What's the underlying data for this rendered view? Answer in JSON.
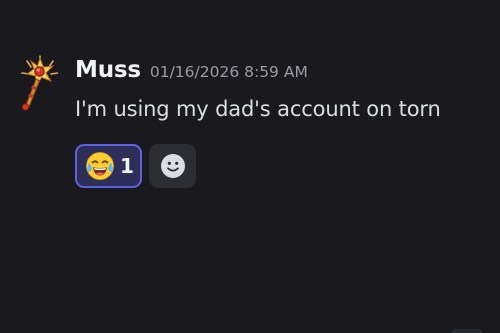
{
  "message": {
    "author": "Muss",
    "timestamp": "01/16/2026 8:59 AM",
    "content": "I'm using my dad's account on torn",
    "avatar_icon": "golden-key-scepter-icon"
  },
  "reactions": [
    {
      "emoji": "joy-emoji-icon",
      "count": "1",
      "reacted_by_me": true
    }
  ],
  "add_reaction": {
    "icon": "smiley-face-icon"
  },
  "colors": {
    "background": "#1a1a1e",
    "username": "#f2f3f5",
    "timestamp": "#9a9ca2",
    "content": "#dbdee1",
    "reaction_bg": "#2d2f59",
    "reaction_border": "#5b63e3",
    "add_reaction_bg": "#2c2d33"
  }
}
